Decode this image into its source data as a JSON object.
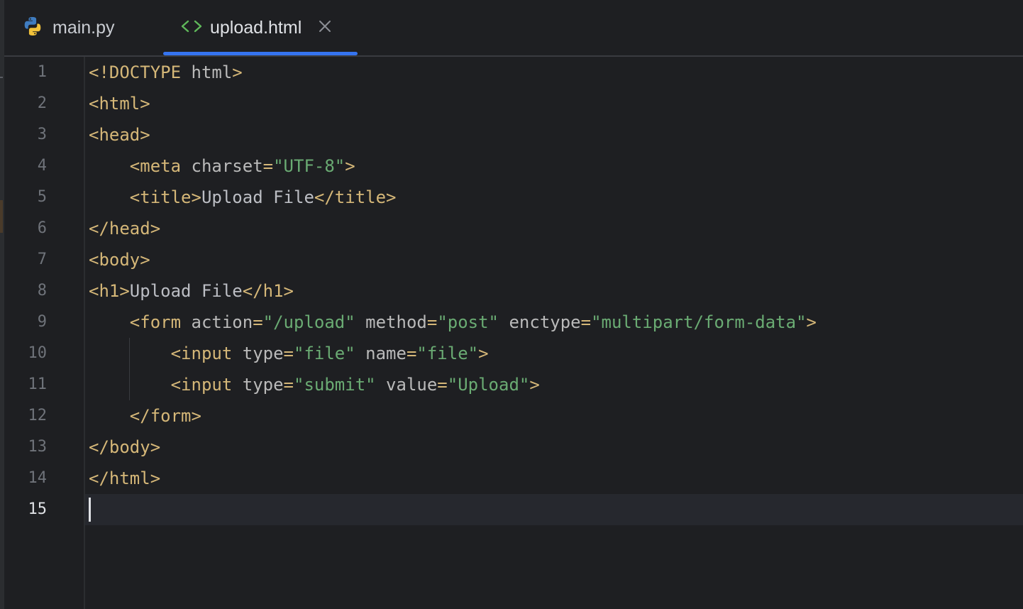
{
  "tabs": [
    {
      "label": "main.py",
      "icon": "python-icon",
      "active": false
    },
    {
      "label": "upload.html",
      "icon": "html-icon",
      "active": true
    }
  ],
  "colors": {
    "tag": "#d5b778",
    "attribute": "#bababa",
    "value": "#6aab73",
    "text": "#bcbec4",
    "accent": "#3574f0"
  },
  "editor": {
    "current_line": 15,
    "lines": [
      {
        "no": "1",
        "tokens": [
          [
            "tg",
            "<!DOCTYPE "
          ],
          [
            "at",
            "html"
          ],
          [
            "tg",
            ">"
          ]
        ]
      },
      {
        "no": "2",
        "tokens": [
          [
            "tg",
            "<html>"
          ]
        ]
      },
      {
        "no": "3",
        "tokens": [
          [
            "tg",
            "<head>"
          ]
        ]
      },
      {
        "no": "4",
        "tokens": [
          [
            "tx",
            "    "
          ],
          [
            "tg",
            "<meta "
          ],
          [
            "at",
            "charset"
          ],
          [
            "tg",
            "="
          ],
          [
            "vl",
            "\"UTF-8\""
          ],
          [
            "tg",
            ">"
          ]
        ]
      },
      {
        "no": "5",
        "tokens": [
          [
            "tx",
            "    "
          ],
          [
            "tg",
            "<title>"
          ],
          [
            "tx",
            "Upload File"
          ],
          [
            "tg",
            "</title>"
          ]
        ]
      },
      {
        "no": "6",
        "tokens": [
          [
            "tg",
            "</head>"
          ]
        ]
      },
      {
        "no": "7",
        "tokens": [
          [
            "tg",
            "<body>"
          ]
        ]
      },
      {
        "no": "8",
        "tokens": [
          [
            "tg",
            "<h1>"
          ],
          [
            "tx",
            "Upload File"
          ],
          [
            "tg",
            "</h1>"
          ]
        ]
      },
      {
        "no": "9",
        "tokens": [
          [
            "tx",
            "    "
          ],
          [
            "tg",
            "<form "
          ],
          [
            "at",
            "action"
          ],
          [
            "tg",
            "="
          ],
          [
            "vl",
            "\"/upload\""
          ],
          [
            "tx",
            " "
          ],
          [
            "at",
            "method"
          ],
          [
            "tg",
            "="
          ],
          [
            "vl",
            "\"post\""
          ],
          [
            "tx",
            " "
          ],
          [
            "at",
            "enctype"
          ],
          [
            "tg",
            "="
          ],
          [
            "vl",
            "\"multipart/form-data\""
          ],
          [
            "tg",
            ">"
          ]
        ]
      },
      {
        "no": "10",
        "tokens": [
          [
            "tx",
            "        "
          ],
          [
            "tg",
            "<input "
          ],
          [
            "at",
            "type"
          ],
          [
            "tg",
            "="
          ],
          [
            "vl",
            "\"file\""
          ],
          [
            "tx",
            " "
          ],
          [
            "at",
            "name"
          ],
          [
            "tg",
            "="
          ],
          [
            "vl",
            "\"file\""
          ],
          [
            "tg",
            ">"
          ]
        ]
      },
      {
        "no": "11",
        "tokens": [
          [
            "tx",
            "        "
          ],
          [
            "tg",
            "<input "
          ],
          [
            "at",
            "type"
          ],
          [
            "tg",
            "="
          ],
          [
            "vl",
            "\"submit\""
          ],
          [
            "tx",
            " "
          ],
          [
            "at",
            "value"
          ],
          [
            "tg",
            "="
          ],
          [
            "vl",
            "\"Upload\""
          ],
          [
            "tg",
            ">"
          ]
        ]
      },
      {
        "no": "12",
        "tokens": [
          [
            "tx",
            "    "
          ],
          [
            "tg",
            "</form>"
          ]
        ]
      },
      {
        "no": "13",
        "tokens": [
          [
            "tg",
            "</body>"
          ]
        ]
      },
      {
        "no": "14",
        "tokens": [
          [
            "tg",
            "</html>"
          ]
        ]
      },
      {
        "no": "15",
        "tokens": []
      }
    ]
  }
}
